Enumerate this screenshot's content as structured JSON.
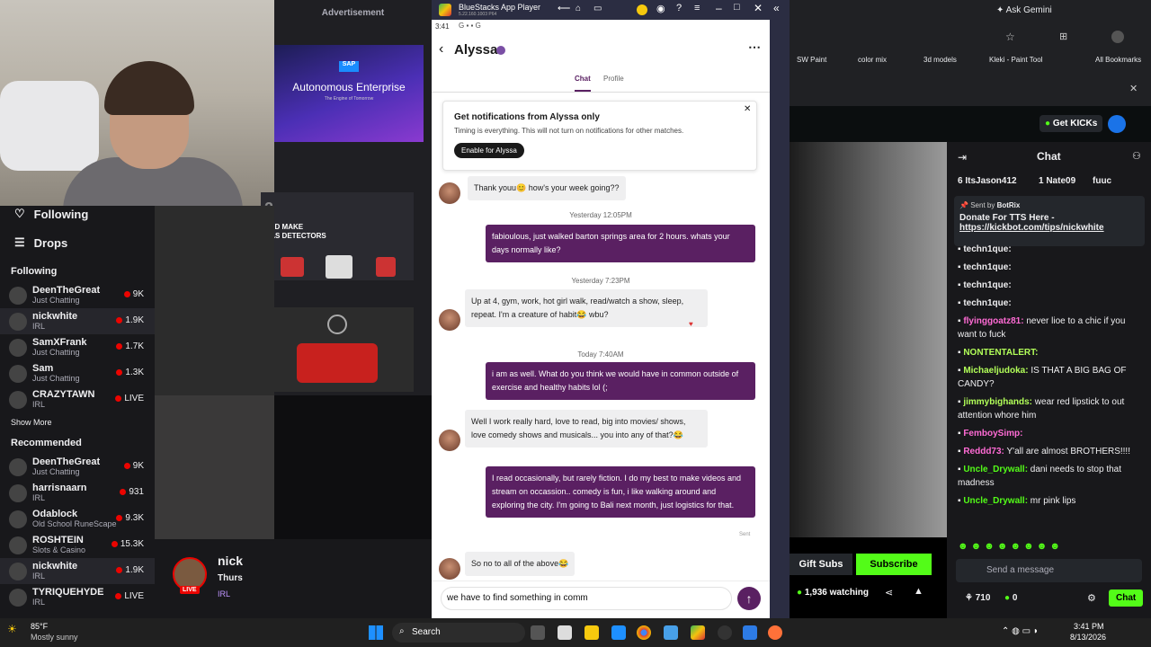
{
  "ads": {
    "title": "Advertisement",
    "sap_brand": "SAP",
    "sap_title": "Autonomous Enterprise",
    "sap_sub": "The Engine of Tomorrow",
    "gas_num": "2",
    "gas_text": "AND MAKE",
    "gas_text2": "GAS DETECTORS"
  },
  "twitch": {
    "following_label": "Following",
    "drops_label": "Drops",
    "section_following": "Following",
    "section_recommended": "Recommended",
    "show_more": "Show More",
    "following": [
      {
        "name": "DeenTheGreat",
        "sub": "Just Chatting",
        "viewers": "9K"
      },
      {
        "name": "nickwhite",
        "sub": "IRL",
        "viewers": "1.9K"
      },
      {
        "name": "SamXFrank",
        "sub": "Just Chatting",
        "viewers": "1.7K"
      },
      {
        "name": "Sam",
        "sub": "Just Chatting",
        "viewers": "1.3K"
      },
      {
        "name": "CRAZYTAWN",
        "sub": "IRL",
        "viewers": "LIVE"
      }
    ],
    "recommended": [
      {
        "name": "DeenTheGreat",
        "sub": "Just Chatting",
        "viewers": "9K"
      },
      {
        "name": "harrisnaarn",
        "sub": "IRL",
        "viewers": "931"
      },
      {
        "name": "Odablock",
        "sub": "Old School RuneScape",
        "viewers": "9.3K"
      },
      {
        "name": "ROSHTEIN",
        "sub": "Slots & Casino",
        "viewers": "15.3K"
      },
      {
        "name": "nickwhite",
        "sub": "IRL",
        "viewers": "1.9K"
      },
      {
        "name": "TYRIQUEHYDE",
        "sub": "IRL",
        "viewers": "LIVE"
      }
    ],
    "streamer_name": "nick",
    "streamer_day": "Thurs",
    "streamer_cat": "IRL",
    "live_badge": "LIVE"
  },
  "bluestacks": {
    "title": "BlueStacks App Player",
    "version": "5.22.160.1003 P64"
  },
  "phone": {
    "time": "3:41",
    "contact": "Alyssa",
    "tab_chat": "Chat",
    "tab_profile": "Profile",
    "notif_title": "Get notifications from Alyssa only",
    "notif_body": "Timing is everything. This will not turn on notifications for other matches.",
    "notif_button": "Enable for Alyssa",
    "messages": [
      {
        "from": "them",
        "text": "Thank youu😊 how's your week going??"
      },
      {
        "ts": "Yesterday 12:05PM"
      },
      {
        "from": "me",
        "text": "fabioulous, just walked barton springs area for 2 hours. whats your days normally like?"
      },
      {
        "ts": "Yesterday 7:23PM"
      },
      {
        "from": "them",
        "text": "Up at 4, gym, work, hot girl walk, read/watch a show, sleep, repeat. I'm a creature of habit😂 wbu?"
      },
      {
        "ts": "Today 7:40AM"
      },
      {
        "from": "me",
        "text": "i am as well. What do you think we would have in common outside of exercise and healthy habits lol (;"
      },
      {
        "from": "them",
        "text": "Well I work really hard, love to read, big into movies/ shows, love comedy shows and musicals... you into any of that?😂"
      },
      {
        "from": "me",
        "text": "I read occasionally, but rarely fiction. I do my best to make videos and stream on occassion.. comedy is fun, i like walking around and exploring the city. I'm going to Bali next month, just logistics for that."
      },
      {
        "from": "them",
        "text": "So no to all of the above😂"
      }
    ],
    "sent_label": "Sent",
    "compose_value": "we have to find something in comm"
  },
  "browser": {
    "ask_gemini": "Ask Gemini",
    "bookmarks": [
      "SW Paint",
      "color mix",
      "3d models",
      "Kleki - Paint Tool"
    ],
    "all_bookmarks": "All Bookmarks",
    "get_kicks": "Get KICKs"
  },
  "chat": {
    "title": "Chat",
    "top_gifters": [
      {
        "name": "ItsJason412",
        "n": "6"
      },
      {
        "name": "Nate09",
        "n": "1"
      },
      {
        "name": "fuuc",
        "n": ""
      }
    ],
    "pinned_by": "Sent by",
    "pinned_bot": "BotRix",
    "pinned_text": "Donate For TTS Here -",
    "pinned_link": "https://kickbot.com/tips/nickwhite",
    "messages": [
      {
        "user": "techn1que",
        "text": "",
        "color": "#efeff1"
      },
      {
        "user": "techn1que",
        "text": "",
        "color": "#efeff1"
      },
      {
        "user": "techn1que",
        "text": "",
        "color": "#efeff1"
      },
      {
        "user": "techn1que",
        "text": "",
        "color": "#efeff1"
      },
      {
        "user": "flyinggoatz81",
        "text": "never lioe to a chic if you want to fuck",
        "color": "#ff6bd5"
      },
      {
        "user": "NONTENTALERT",
        "text": "",
        "color": "#b2ff59"
      },
      {
        "user": "Michaeljudoka",
        "text": "IS THAT A BIG BAG OF CANDY?",
        "color": "#b2ff59"
      },
      {
        "user": "jimmybighands",
        "text": "wear red lipstick to out attention whore him",
        "color": "#b2ff59"
      },
      {
        "user": "FemboySimp",
        "text": "",
        "color": "#ff6bd5"
      },
      {
        "user": "Reddd73",
        "text": "Y'all are almost BROTHERS!!!!",
        "color": "#ff6bd5"
      },
      {
        "user": "Uncle_Drywall",
        "text": "dani needs to stop that madness",
        "color": "#53fc18"
      },
      {
        "user": "Uncle_Drywall",
        "text": "mr pink lips",
        "color": "#53fc18"
      }
    ],
    "gift_subs": "Gift Subs",
    "subscribe": "Subscribe",
    "placeholder": "Send a message",
    "watching": "1,936 watching",
    "points": "710",
    "kicks": "0",
    "chat_button": "Chat"
  },
  "taskbar": {
    "temp": "85°F",
    "weather": "Mostly sunny",
    "search": "Search",
    "time": "3:41 PM",
    "date": "8/13/2026"
  }
}
